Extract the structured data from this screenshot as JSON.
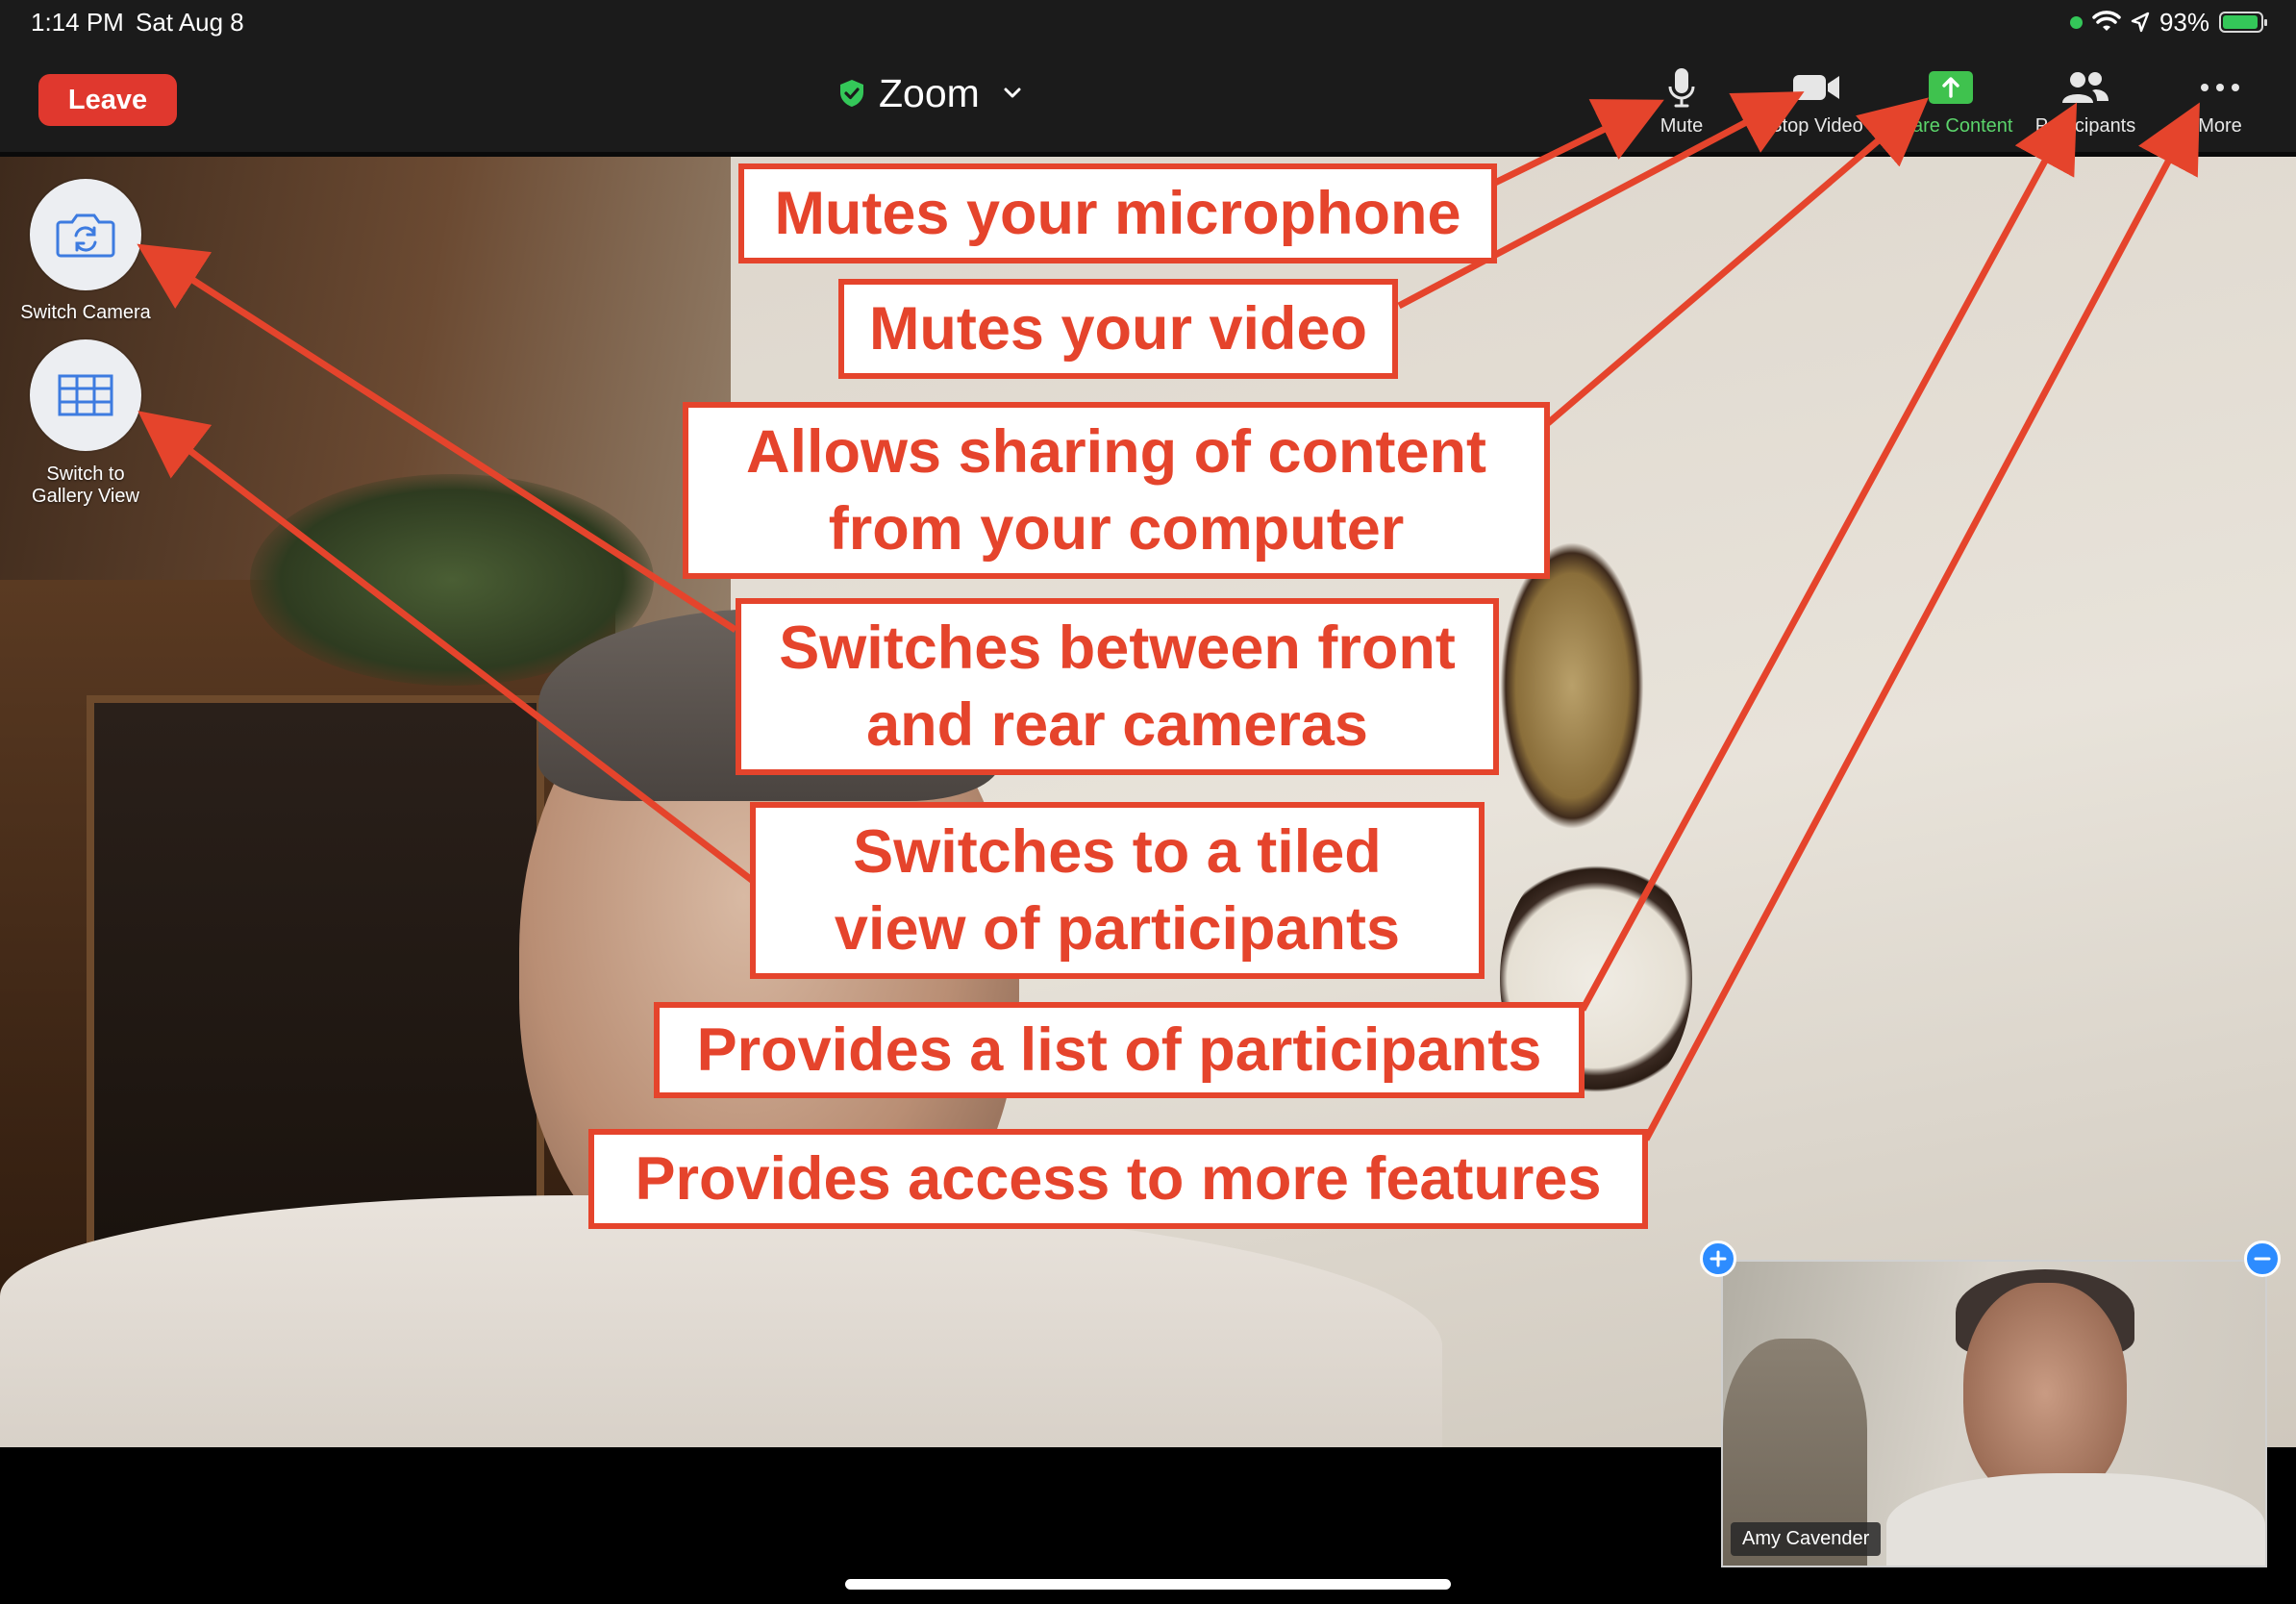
{
  "status_bar": {
    "time": "1:14 PM",
    "date": "Sat Aug 8",
    "battery": "93%",
    "battery_level": 0.93,
    "icons": [
      "green-dot-icon",
      "wifi-icon",
      "location-arrow-icon",
      "battery-charging-icon"
    ]
  },
  "toolbar": {
    "leave_label": "Leave",
    "title": "Zoom",
    "title_icons": [
      "shield-check-icon",
      "chevron-down-icon"
    ],
    "items": [
      {
        "label": "Mute",
        "icon": "microphone-icon"
      },
      {
        "label": "Stop Video",
        "icon": "video-camera-icon"
      },
      {
        "label": "Share Content",
        "icon": "share-arrow-icon"
      },
      {
        "label": "Participants",
        "icon": "participants-icon"
      },
      {
        "label": "More",
        "icon": "more-dots-icon"
      }
    ]
  },
  "left_controls": {
    "switch_camera_label": "Switch Camera",
    "gallery_view_label": "Switch to\nGallery View"
  },
  "callouts": [
    "Mutes your microphone",
    "Mutes your video",
    "Allows sharing of content\nfrom your computer",
    "Switches between front\nand rear cameras",
    "Switches to a tiled\nview of participants",
    "Provides a list of participants",
    "Provides access to more features"
  ],
  "self_view": {
    "name": "Amy Cavender"
  },
  "colors": {
    "accent_red": "#e5442c",
    "leave_red": "#e0382e",
    "share_green": "#5bd46b",
    "zoom_blue": "#2d8cff"
  }
}
